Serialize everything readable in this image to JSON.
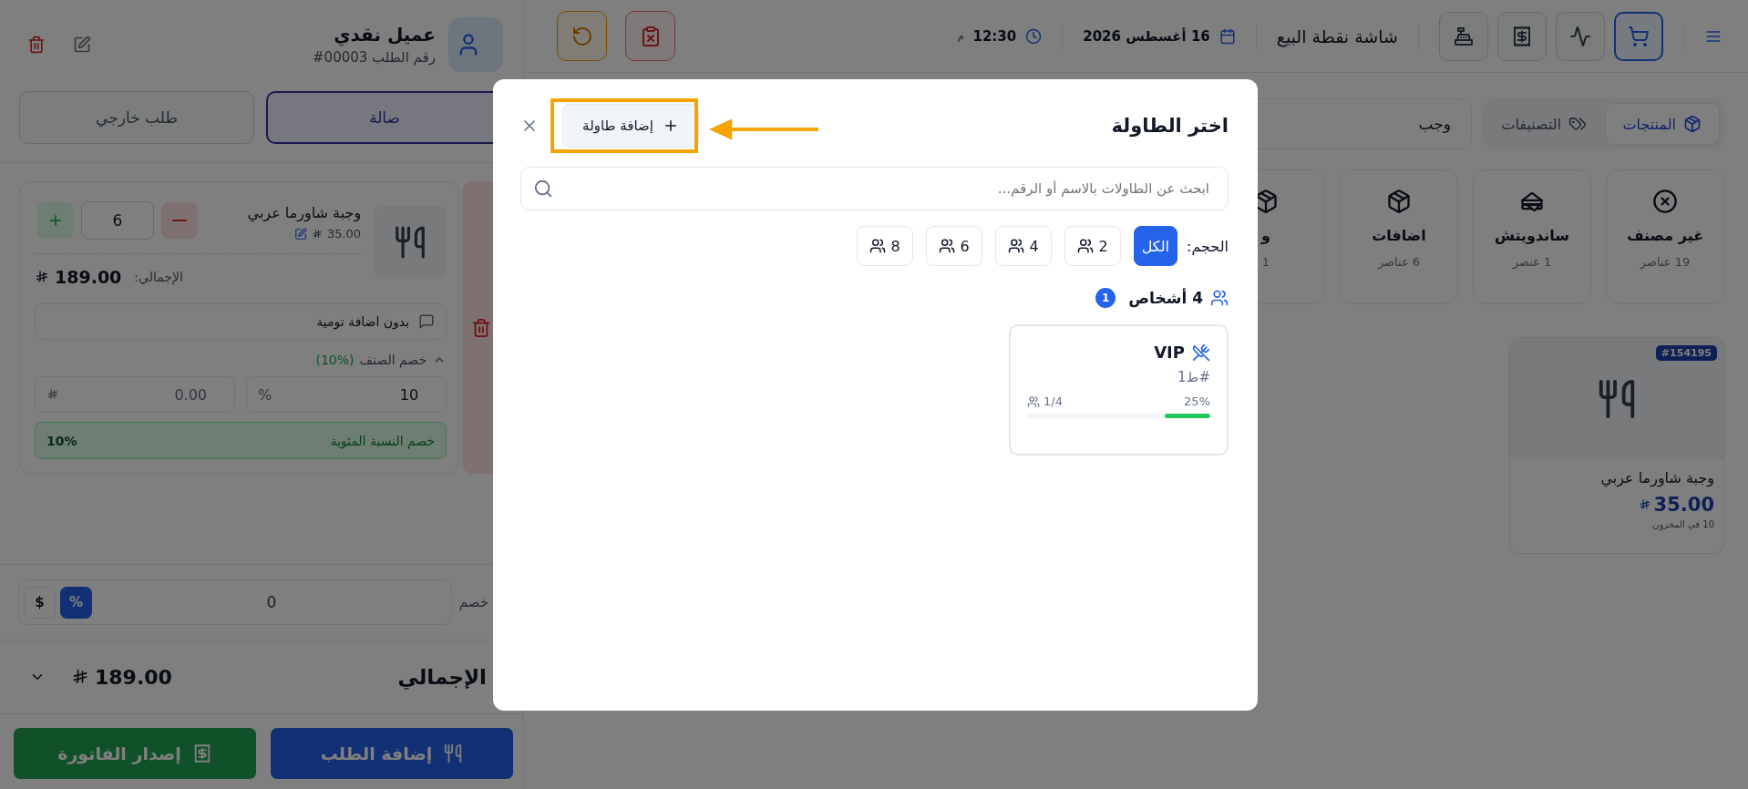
{
  "top_bar": {
    "title": "شاشة نقطة البيع",
    "date": "16 أغسطس 2026",
    "time": "12:30",
    "time_suffix": "م",
    "tool_buttons": [
      {
        "selected": true
      },
      {
        "selected": false
      },
      {
        "selected": false
      },
      {
        "selected": false
      }
    ]
  },
  "view_tabs": [
    {
      "label": "المنتجات",
      "selected": true
    },
    {
      "label": "التصنيفات",
      "selected": false
    }
  ],
  "search": {
    "value": "وجب"
  },
  "categories": [
    {
      "name": "غير مصنف",
      "count": "19 عناصر"
    },
    {
      "name": "ساندويتش",
      "count": "1 عنصر"
    },
    {
      "name": "اضافات",
      "count": "6 عناصر"
    },
    {
      "name": "و",
      "count": "1"
    }
  ],
  "products": [
    {
      "badge": "#154195",
      "name": "وجبة شاورما عربي",
      "price": "35.00",
      "stock": "10 في المخزون"
    }
  ],
  "order_panel": {
    "customer_name": "عميل نقدي",
    "order_number": "رقم الطلب 00003#",
    "order_types": [
      {
        "label": "صالة",
        "selected": true
      },
      {
        "label": "طلب خارجي",
        "selected": false
      }
    ],
    "items": [
      {
        "name": "وجبة شاورما عربي",
        "price": "35.00",
        "quantity": "6",
        "total_label": "الإجمالي:",
        "total": "189.00",
        "note": "بدون اضافة تومية",
        "discount_title": "خصم الصنف",
        "discount_rate": "(10%)",
        "discount_expanded": true,
        "discount_percent": "10",
        "percent_sign": "%",
        "discount_amount": "0.00",
        "discount_summary_label": "خصم النسبة المئوية",
        "discount_summary_value": "10%"
      }
    ],
    "discount": {
      "label": "خصم",
      "value": "0",
      "modes": [
        {
          "label": "%",
          "selected": true
        },
        {
          "label": "$",
          "selected": false
        }
      ]
    },
    "total": {
      "label": "الإجمالي",
      "value": "189.00",
      "expanded": false
    },
    "actions": [
      {
        "label": "إضافة الطلب",
        "kind": "order"
      },
      {
        "label": "إصدار الفاتورة",
        "kind": "invoice"
      }
    ]
  },
  "dialog": {
    "title": "اختر الطاولة",
    "add_button": "إضافة طاولة",
    "search_placeholder": "ابحث عن الطاولات بالاسم أو الرقم...",
    "size_label": "الحجم:",
    "size_filters": [
      {
        "label": "الكل",
        "kind": "all",
        "selected": true
      },
      {
        "label": "2",
        "kind": "size",
        "selected": false
      },
      {
        "label": "4",
        "kind": "size",
        "selected": false
      },
      {
        "label": "6",
        "kind": "size",
        "selected": false
      },
      {
        "label": "8",
        "kind": "size",
        "selected": false
      }
    ],
    "groups": [
      {
        "title": "4 أشخاص",
        "count": "1",
        "tables": [
          {
            "name": "VIP",
            "code": "1ط#",
            "occupancy": "1/4",
            "percent": "25%",
            "level": 0.25
          }
        ]
      }
    ]
  }
}
